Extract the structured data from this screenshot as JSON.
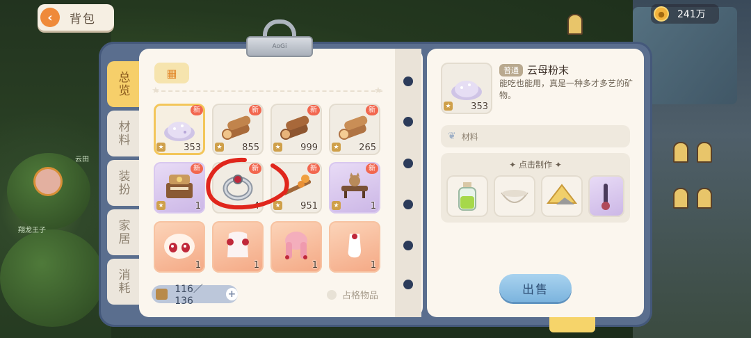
{
  "header": {
    "back_label": "背包",
    "coins": "241万"
  },
  "clip_text": "AoGi",
  "tabs": [
    {
      "label": "总览",
      "active": true
    },
    {
      "label": "材料",
      "active": false
    },
    {
      "label": "装扮",
      "active": false
    },
    {
      "label": "家居",
      "active": false
    },
    {
      "label": "消耗",
      "active": false
    }
  ],
  "inventory": {
    "category_icon": "grid-icon",
    "items": [
      {
        "name": "mica-powder",
        "qty": "353",
        "new": "新",
        "bg": "white",
        "selected": true
      },
      {
        "name": "wood-log",
        "qty": "855",
        "new": "新",
        "bg": "white"
      },
      {
        "name": "wood-log",
        "qty": "999",
        "new": "新",
        "bg": "white"
      },
      {
        "name": "wood-log",
        "qty": "265",
        "new": "新",
        "bg": "white"
      },
      {
        "name": "vanity-desk",
        "qty": "1",
        "new": "新",
        "bg": "purple"
      },
      {
        "name": "silver-ring",
        "qty": "4",
        "new": "新",
        "bg": "white"
      },
      {
        "name": "wooden-branch",
        "qty": "951",
        "new": "新",
        "bg": "white"
      },
      {
        "name": "cat-table",
        "qty": "1",
        "new": "新",
        "bg": "purple"
      },
      {
        "name": "face-makeup",
        "qty": "1",
        "bg": "orange"
      },
      {
        "name": "lace-outfit",
        "qty": "1",
        "bg": "orange"
      },
      {
        "name": "pink-hair",
        "qty": "1",
        "bg": "orange"
      },
      {
        "name": "white-sock",
        "qty": "1",
        "bg": "orange"
      }
    ],
    "capacity": "116／136",
    "occupy_label": "占格物品"
  },
  "detail": {
    "quality": "普通",
    "name": "云母粉末",
    "description": "能吃也能用，真是一种多才多艺的矿物。",
    "qty": "353",
    "type_label": "材料",
    "craft_title": "点击制作",
    "craft_items": [
      "green-potion-icon",
      "bowl-icon",
      "cheese-icon",
      "purple-item-icon"
    ],
    "sell_label": "出售"
  },
  "scene": {
    "label_left_1": "云田",
    "label_left_2": "翔龙王子"
  },
  "colors": {
    "accent_orange": "#ef8a3a",
    "new_badge": "#f2674f",
    "board": "#5a6e8e",
    "annotation_red": "#e0261c"
  }
}
